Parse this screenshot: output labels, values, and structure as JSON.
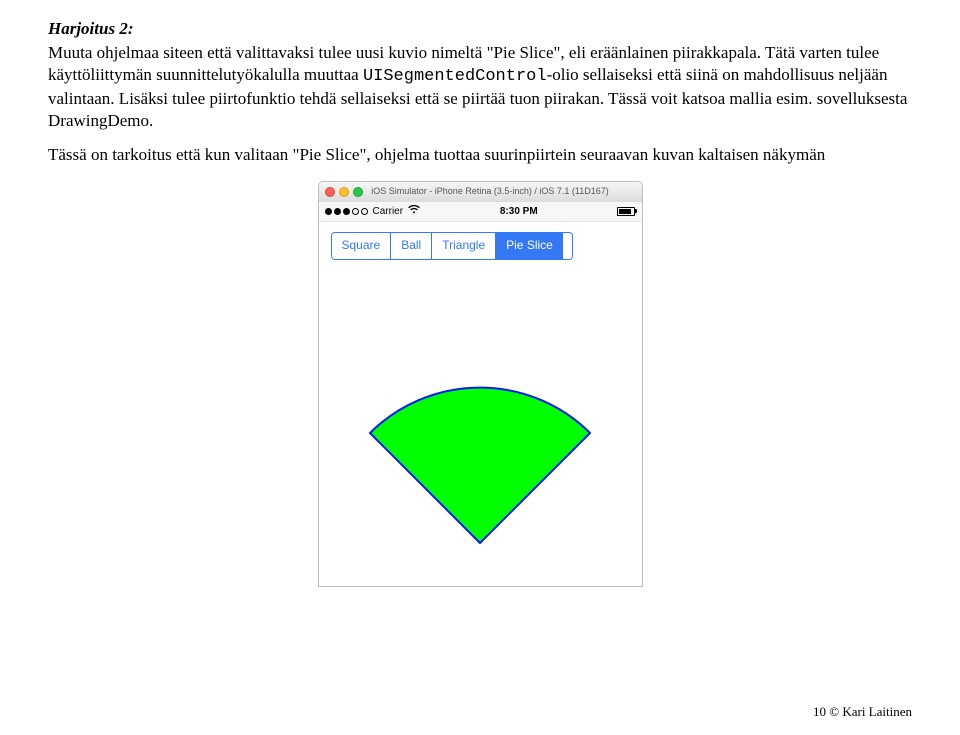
{
  "doc": {
    "heading": "Harjoitus 2:",
    "p1a": "Muuta ohjelmaa siteen että valittavaksi tulee uusi kuvio nimeltä \"Pie Slice\", eli eräänlainen piirakkapala. Tätä varten tulee käyttöliittymän suunnittelutyökalulla muuttaa ",
    "p1code": "UISegmentedControl",
    "p1b": "-olio sellaiseksi että siinä on mahdollisuus neljään valintaan. Lisäksi tulee piirtofunktio tehdä sellaiseksi että se piirtää tuon piirakan. Tässä voit katsoa mallia esim. sovelluksesta DrawingDemo.",
    "p2": "Tässä on tarkoitus että kun valitaan \"Pie Slice\", ohjelma tuottaa suurinpiirtein seuraavan kuvan kaltaisen näkymän"
  },
  "sim": {
    "titlebar": "iOS Simulator - iPhone Retina (3.5-inch) / iOS 7.1 (11D167)",
    "carrier": "Carrier",
    "time": "8:30 PM",
    "segments": [
      "Square",
      "Ball",
      "Triangle",
      "Pie Slice"
    ],
    "selectedIndex": 3
  },
  "footer": {
    "page": "10 © Kari Laitinen"
  }
}
